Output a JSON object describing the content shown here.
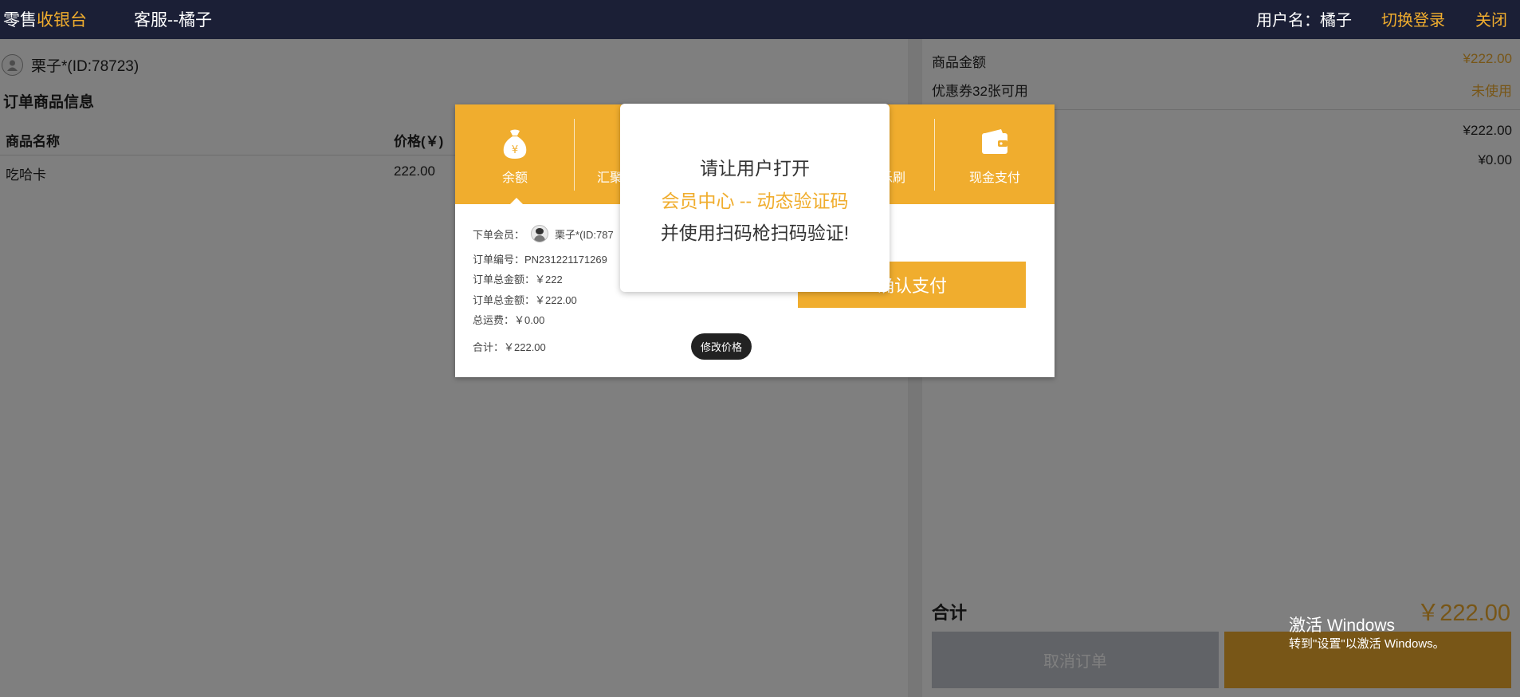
{
  "topbar": {
    "brand_part1": "零售",
    "brand_part2": "收银台",
    "service": "客服--橘子",
    "username": "用户名：橘子",
    "switch_login": "切换登录",
    "close": "关闭"
  },
  "left": {
    "member": "栗子*(ID:78723)",
    "section_title": "订单商品信息",
    "table": {
      "headers": [
        "商品名称",
        "价格(￥)"
      ],
      "rows": [
        {
          "name": "吃哈卡",
          "price": "222.00"
        }
      ]
    }
  },
  "right": {
    "lines": [
      {
        "label": "商品金额",
        "value": "¥222.00"
      },
      {
        "label": "优惠券32张可用",
        "value": "未使用"
      },
      {
        "label": "",
        "value": "¥222.00"
      },
      {
        "label": "",
        "value": "¥0.00"
      }
    ],
    "total_label": "合计",
    "total_value": "￥222.00",
    "cancel_button": "取消订单",
    "windows_activate": "激活 Windows",
    "windows_sub": "转到\"设置\"以激活 Windows。"
  },
  "pay_modal": {
    "tabs": [
      {
        "label": "余额",
        "icon": "money-bag-icon"
      },
      {
        "label": "汇聚支付",
        "icon": ""
      },
      {
        "label": "乐刷",
        "icon": ""
      },
      {
        "label": "现金支付",
        "icon": "wallet-icon"
      }
    ],
    "member_label": "下单会员：",
    "member_value": "栗子*(ID:787",
    "order_no": "订单编号：PN231221171269",
    "order_total_1": "订单总金额：￥222",
    "order_total_2": "订单总金额：￥222.00",
    "shipping": "总运费：￥0.00",
    "subtotal": "合计：￥222.00",
    "modify_price": "修改价格",
    "confirm_pay": "确认支付"
  },
  "prompt": {
    "line1": "请让用户打开",
    "line2": "会员中心 -- 动态验证码",
    "line3": "并使用扫码枪扫码验证!"
  },
  "colors": {
    "accent": "#f0ad2e",
    "topbar": "#1b1f36"
  }
}
